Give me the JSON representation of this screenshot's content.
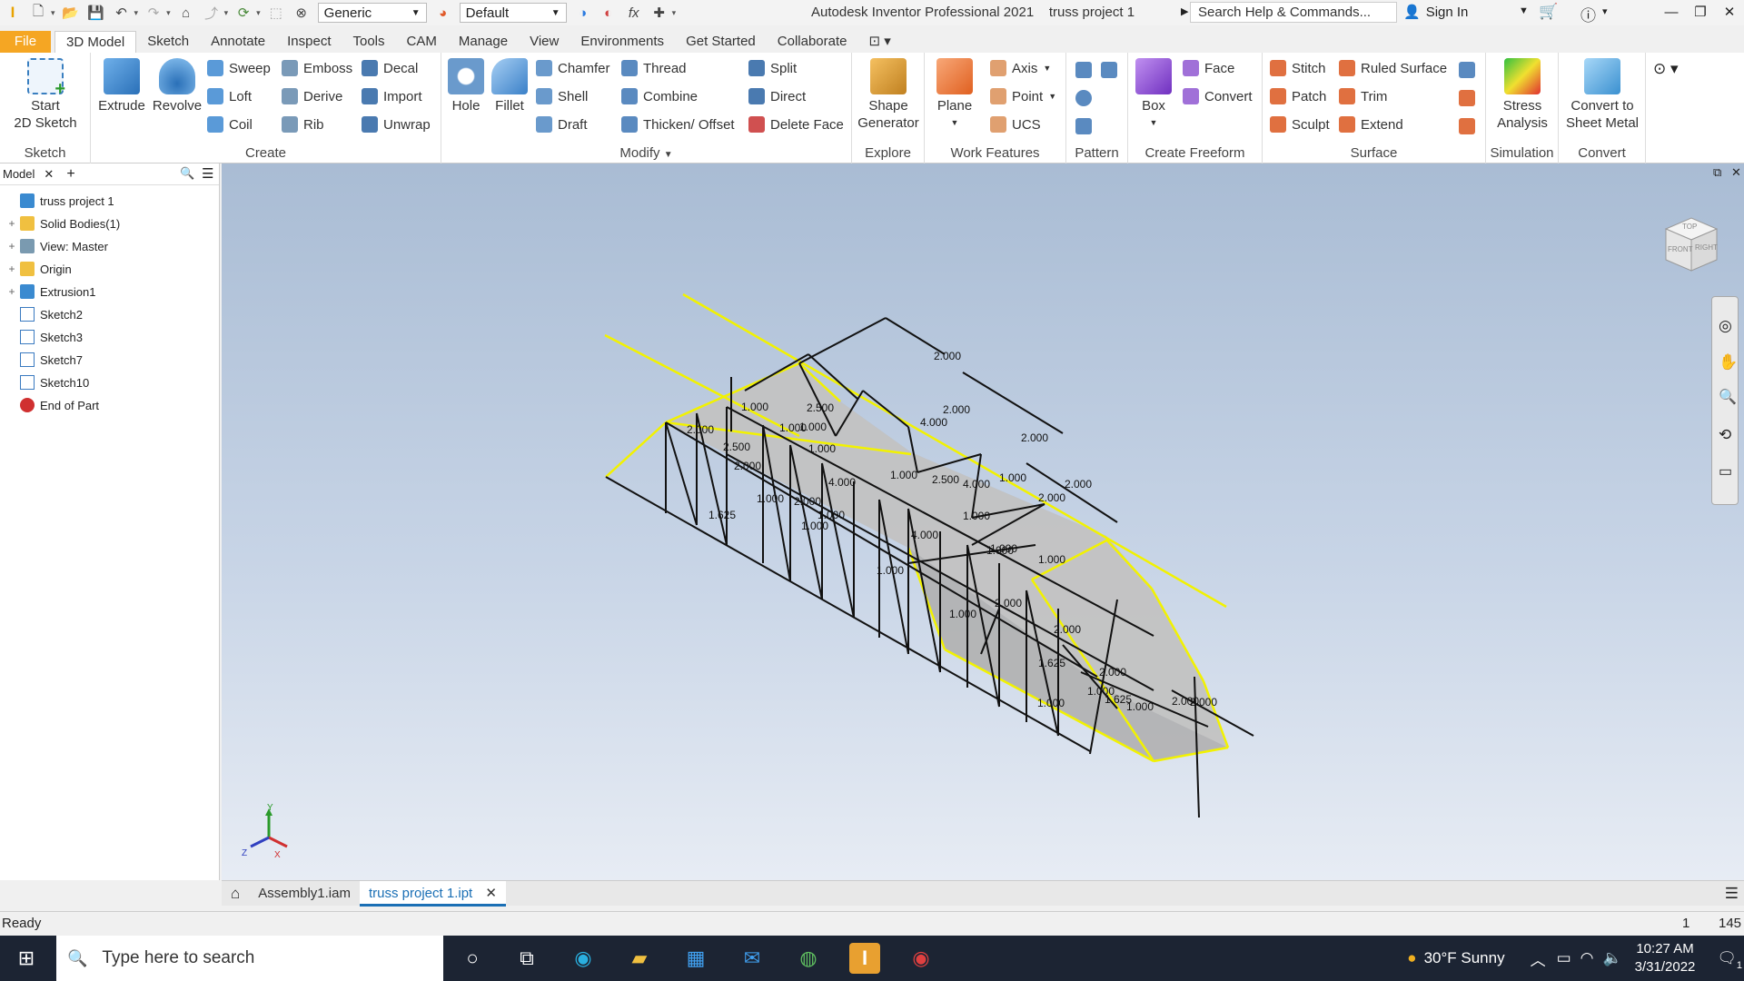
{
  "titlebar": {
    "appearance_combo": "Generic",
    "material_combo": "Default",
    "app_title": "Autodesk Inventor Professional 2021",
    "doc_title": "truss project 1",
    "search_placeholder": "Search Help & Commands...",
    "sign_in": "Sign In"
  },
  "tabs": [
    "File",
    "3D Model",
    "Sketch",
    "Annotate",
    "Inspect",
    "Tools",
    "CAM",
    "Manage",
    "View",
    "Environments",
    "Get Started",
    "Collaborate"
  ],
  "ribbon": {
    "sketch": {
      "title": "Sketch",
      "start": "Start",
      "start2": "2D Sketch"
    },
    "create": {
      "title": "Create",
      "extrude": "Extrude",
      "revolve": "Revolve",
      "sweep": "Sweep",
      "loft": "Loft",
      "coil": "Coil",
      "emboss": "Emboss",
      "derive": "Derive",
      "rib": "Rib",
      "decal": "Decal",
      "import": "Import",
      "unwrap": "Unwrap"
    },
    "modify": {
      "title": "Modify",
      "hole": "Hole",
      "fillet": "Fillet",
      "chamfer": "Chamfer",
      "shell": "Shell",
      "draft": "Draft",
      "thread": "Thread",
      "combine": "Combine",
      "thicken": "Thicken/ Offset",
      "split": "Split",
      "direct": "Direct",
      "delete_face": "Delete Face"
    },
    "explore": {
      "title": "Explore",
      "shape1": "Shape",
      "shape2": "Generator"
    },
    "work": {
      "title": "Work Features",
      "plane": "Plane",
      "axis": "Axis",
      "point": "Point",
      "ucs": "UCS"
    },
    "pattern": {
      "title": "Pattern"
    },
    "freeform": {
      "title": "Create Freeform",
      "box": "Box",
      "face": "Face",
      "convert": "Convert"
    },
    "surface": {
      "title": "Surface",
      "stitch": "Stitch",
      "patch": "Patch",
      "sculpt": "Sculpt",
      "ruled": "Ruled Surface",
      "trim": "Trim",
      "extend": "Extend"
    },
    "simulation": {
      "title": "Simulation",
      "stress1": "Stress",
      "stress2": "Analysis"
    },
    "convert": {
      "title": "Convert",
      "c1": "Convert to",
      "c2": "Sheet Metal"
    }
  },
  "browser": {
    "tab_label": "Model",
    "items": [
      {
        "label": "truss project 1",
        "icon": "part-icon"
      },
      {
        "label": "Solid Bodies(1)",
        "icon": "folder-icon"
      },
      {
        "label": "View: Master",
        "icon": "view-icon"
      },
      {
        "label": "Origin",
        "icon": "folder-icon"
      },
      {
        "label": "Extrusion1",
        "icon": "extrusion-icon"
      },
      {
        "label": "Sketch2",
        "icon": "sketch-icon"
      },
      {
        "label": "Sketch3",
        "icon": "sketch-icon"
      },
      {
        "label": "Sketch7",
        "icon": "sketch-icon"
      },
      {
        "label": "Sketch10",
        "icon": "sketch-icon"
      },
      {
        "label": "End of Part",
        "icon": "end-of-part-icon"
      }
    ]
  },
  "dimensions": [
    "2.000",
    "2.000",
    "4.000",
    "2.000",
    "2.000",
    "1.000",
    "2.500",
    "1.000",
    "1.000",
    "1.000",
    "2.000",
    "2.500",
    "2.000",
    "1.625",
    "1.000",
    "2.000",
    "1.000",
    "4.000",
    "1.000",
    "2.500",
    "4.000",
    "1.000",
    "1.000",
    "1.000",
    "2.000",
    "4.000",
    "1.000",
    "1.000",
    "1.000",
    "1.000",
    "1.000",
    "2.000",
    "2.000",
    "1.625",
    "2.000",
    "1.000",
    "1.000",
    "1.625",
    "2.000",
    "2.000",
    "1.000"
  ],
  "viewcube": {
    "top": "TOP",
    "front": "FRONT",
    "right": "RIGHT"
  },
  "doc_tabs": {
    "assembly": "Assembly1.iam",
    "part": "truss project 1.ipt"
  },
  "status": {
    "text": "Ready",
    "n1": "1",
    "n2": "145"
  },
  "taskbar": {
    "search_placeholder": "Type here to search",
    "weather": "30°F  Sunny",
    "time": "10:27 AM",
    "date": "3/31/2022",
    "notifications": "1"
  },
  "colors": {
    "accent": "#1a6fb5",
    "file_tab": "#f5a623",
    "taskbar": "#1c2433",
    "edge_yellow": "#f2f200"
  }
}
